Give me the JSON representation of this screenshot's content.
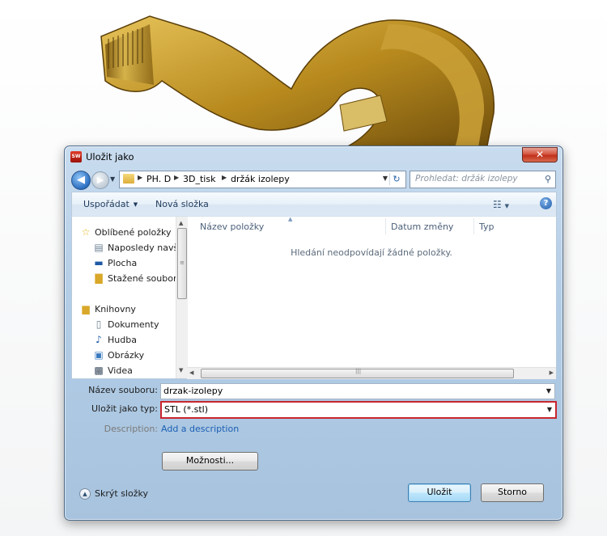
{
  "window": {
    "title": "Uložit jako",
    "close_symbol": "✕"
  },
  "address": {
    "crumbs": [
      "PH. D",
      "3D_tisk",
      "držák izolepy"
    ]
  },
  "search": {
    "placeholder": "Prohledat: držák izolepy"
  },
  "toolbar": {
    "organize_label": "Uspořádat",
    "new_folder_label": "Nová složka"
  },
  "nav": {
    "favorites_header": "Oblíbené položky",
    "favorites": [
      "Naposledy navští",
      "Plocha",
      "Stažené soubory"
    ],
    "libraries_header": "Knihovny",
    "libraries": [
      "Dokumenty",
      "Hudba",
      "Obrázky",
      "Videa"
    ]
  },
  "files": {
    "columns": [
      "Název položky",
      "Datum změny",
      "Typ"
    ],
    "empty_message": "Hledání neodpovídají žádné položky."
  },
  "fields": {
    "filename_label": "Název souboru:",
    "filename_value": "drzak-izolepy",
    "filetype_label": "Uložit jako typ:",
    "filetype_value": "STL (*.stl)",
    "description_label": "Description:",
    "description_link": "Add a description"
  },
  "buttons": {
    "options_label": "Možnosti...",
    "save_label": "Uložit",
    "cancel_label": "Storno",
    "hide_folders_label": "Skrýt složky"
  },
  "colors": {
    "highlight_border": "#c8262e",
    "dialog_frame": "#b3cde6",
    "link": "#1a5fb4"
  }
}
